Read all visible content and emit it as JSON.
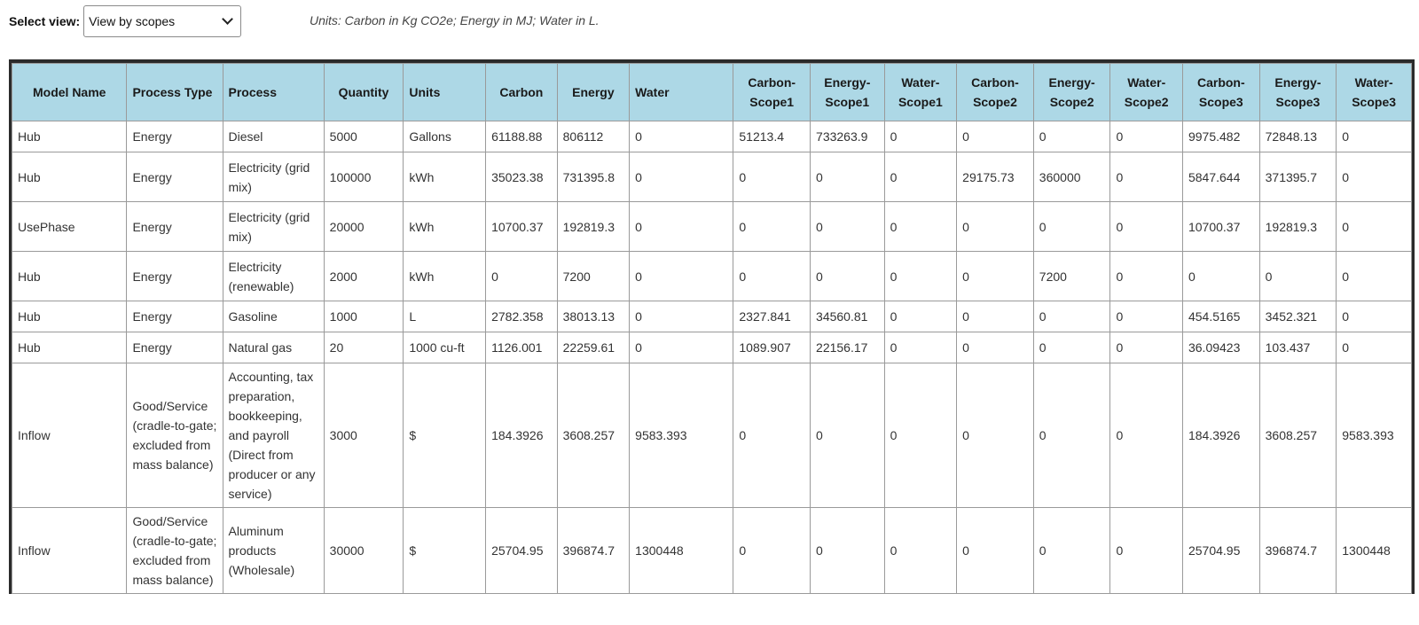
{
  "controls": {
    "select_label": "Select view:",
    "select_value": "View by scopes",
    "units_note": "Units: Carbon in Kg CO2e; Energy in MJ; Water in L."
  },
  "table": {
    "headers": [
      "Model Name",
      "Process Type",
      "Process",
      "Quantity",
      "Units",
      "Carbon",
      "Energy",
      "Water",
      "Carbon-Scope1",
      "Energy-Scope1",
      "Water-Scope1",
      "Carbon-Scope2",
      "Energy-Scope2",
      "Water-Scope2",
      "Carbon-Scope3",
      "Energy-Scope3",
      "Water-Scope3"
    ],
    "rows": [
      [
        "Hub",
        "Energy",
        "Diesel",
        "5000",
        "Gallons",
        "61188.88",
        "806112",
        "0",
        "51213.4",
        "733263.9",
        "0",
        "0",
        "0",
        "0",
        "9975.482",
        "72848.13",
        "0"
      ],
      [
        "Hub",
        "Energy",
        "Electricity (grid mix)",
        "100000",
        "kWh",
        "35023.38",
        "731395.8",
        "0",
        "0",
        "0",
        "0",
        "29175.73",
        "360000",
        "0",
        "5847.644",
        "371395.7",
        "0"
      ],
      [
        "UsePhase",
        "Energy",
        "Electricity (grid mix)",
        "20000",
        "kWh",
        "10700.37",
        "192819.3",
        "0",
        "0",
        "0",
        "0",
        "0",
        "0",
        "0",
        "10700.37",
        "192819.3",
        "0"
      ],
      [
        "Hub",
        "Energy",
        "Electricity (renewable)",
        "2000",
        "kWh",
        "0",
        "7200",
        "0",
        "0",
        "0",
        "0",
        "0",
        "7200",
        "0",
        "0",
        "0",
        "0"
      ],
      [
        "Hub",
        "Energy",
        "Gasoline",
        "1000",
        "L",
        "2782.358",
        "38013.13",
        "0",
        "2327.841",
        "34560.81",
        "0",
        "0",
        "0",
        "0",
        "454.5165",
        "3452.321",
        "0"
      ],
      [
        "Hub",
        "Energy",
        "Natural gas",
        "20",
        "1000 cu-ft",
        "1126.001",
        "22259.61",
        "0",
        "1089.907",
        "22156.17",
        "0",
        "0",
        "0",
        "0",
        "36.09423",
        "103.437",
        "0"
      ],
      [
        "Inflow",
        "Good/Service (cradle-to-gate; excluded from mass balance)",
        "Accounting, tax preparation, bookkeeping, and payroll (Direct from producer or any service)",
        "3000",
        "$",
        "184.3926",
        "3608.257",
        "9583.393",
        "0",
        "0",
        "0",
        "0",
        "0",
        "0",
        "184.3926",
        "3608.257",
        "9583.393"
      ],
      [
        "Inflow",
        "Good/Service (cradle-to-gate; excluded from mass balance)",
        "Aluminum products (Wholesale)",
        "30000",
        "$",
        "25704.95",
        "396874.7",
        "1300448",
        "0",
        "0",
        "0",
        "0",
        "0",
        "0",
        "25704.95",
        "396874.7",
        "1300448"
      ]
    ]
  }
}
